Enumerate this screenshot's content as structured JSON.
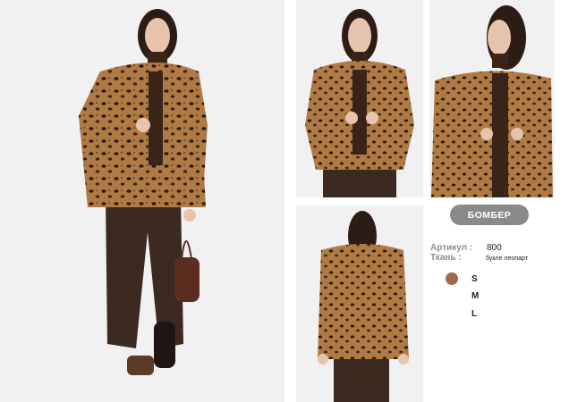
{
  "product": {
    "badge_label": "БОМБЕР",
    "article_label": "Артикул :",
    "article_value": "800",
    "fabric_label": "Ткань :",
    "fabric_value": "букле леопарт"
  },
  "colors": {
    "swatch": "#a0684c",
    "badge_bg": "#8a8a8a",
    "photo_bg": "#f1f1f1",
    "leopard": "#8a5a32",
    "pants": "#3c2a20"
  },
  "sizes": [
    "S",
    "M",
    "L"
  ],
  "photos": {
    "main": "model-full-length-front",
    "front": "model-front-crop",
    "side": "model-three-quarter-crop",
    "back": "model-back-view"
  }
}
